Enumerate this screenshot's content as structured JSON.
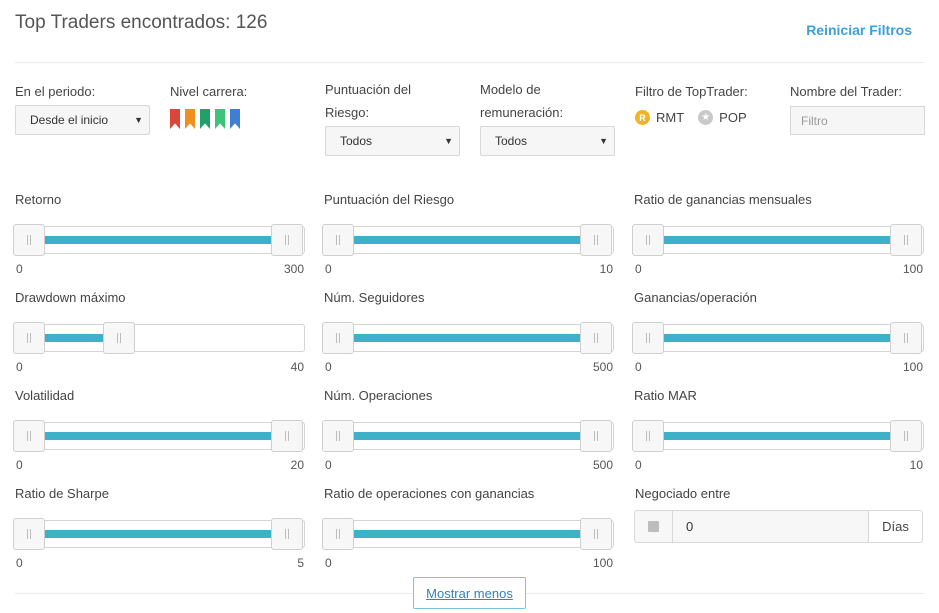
{
  "header": {
    "title": "Top Traders encontrados: 126",
    "reset_label": "Reiniciar Filtros"
  },
  "filters": {
    "period": {
      "label": "En el periodo:",
      "value": "Desde el inicio"
    },
    "career": {
      "label": "Nivel carrera:",
      "ribbon_colors": [
        "#d9463a",
        "#ef8f1e",
        "#22a06a",
        "#3fc37a",
        "#3f7fd1"
      ]
    },
    "risk_score": {
      "label_line1": "Puntuación del",
      "label_line2": "Riesgo:",
      "value": "Todos"
    },
    "remuneration": {
      "label_line1": "Modelo de",
      "label_line2": "remuneración:",
      "value": "Todos"
    },
    "toptrader": {
      "label": "Filtro de TopTrader:",
      "options": [
        {
          "badge": "R",
          "label": "RMT"
        },
        {
          "badge": "★",
          "label": "POP"
        }
      ]
    },
    "trader_name": {
      "label": "Nombre del Trader:",
      "placeholder": "Filtro"
    }
  },
  "sliders": [
    {
      "label": "Retorno",
      "min": "0",
      "max": "300",
      "low_fraction": 0,
      "high_fraction": 1
    },
    {
      "label": "Puntuación del Riesgo",
      "min": "0",
      "max": "10",
      "low_fraction": 0,
      "high_fraction": 1
    },
    {
      "label": "Ratio de ganancias mensuales",
      "min": "0",
      "max": "100",
      "low_fraction": 0,
      "high_fraction": 1
    },
    {
      "label": "Drawdown máximo",
      "min": "0",
      "max": "40",
      "low_fraction": 0,
      "high_fraction": 0.35
    },
    {
      "label": "Núm. Seguidores",
      "min": "0",
      "max": "500",
      "low_fraction": 0,
      "high_fraction": 1
    },
    {
      "label": "Ganancias/operación",
      "min": "0",
      "max": "100",
      "low_fraction": 0,
      "high_fraction": 1
    },
    {
      "label": "Volatilidad",
      "min": "0",
      "max": "20",
      "low_fraction": 0,
      "high_fraction": 1
    },
    {
      "label": "Núm. Operaciones",
      "min": "0",
      "max": "500",
      "low_fraction": 0,
      "high_fraction": 1
    },
    {
      "label": "Ratio MAR",
      "min": "0",
      "max": "10",
      "low_fraction": 0,
      "high_fraction": 1
    },
    {
      "label": "Ratio de Sharpe",
      "min": "0",
      "max": "5",
      "low_fraction": 0,
      "high_fraction": 1
    },
    {
      "label": "Ratio de operaciones con ganancias",
      "min": "0",
      "max": "100",
      "low_fraction": 0,
      "high_fraction": 1
    }
  ],
  "traded_between": {
    "label": "Negociado entre",
    "value": "0",
    "unit": "Días"
  },
  "footer": {
    "show_less_label": "Mostrar menos"
  }
}
